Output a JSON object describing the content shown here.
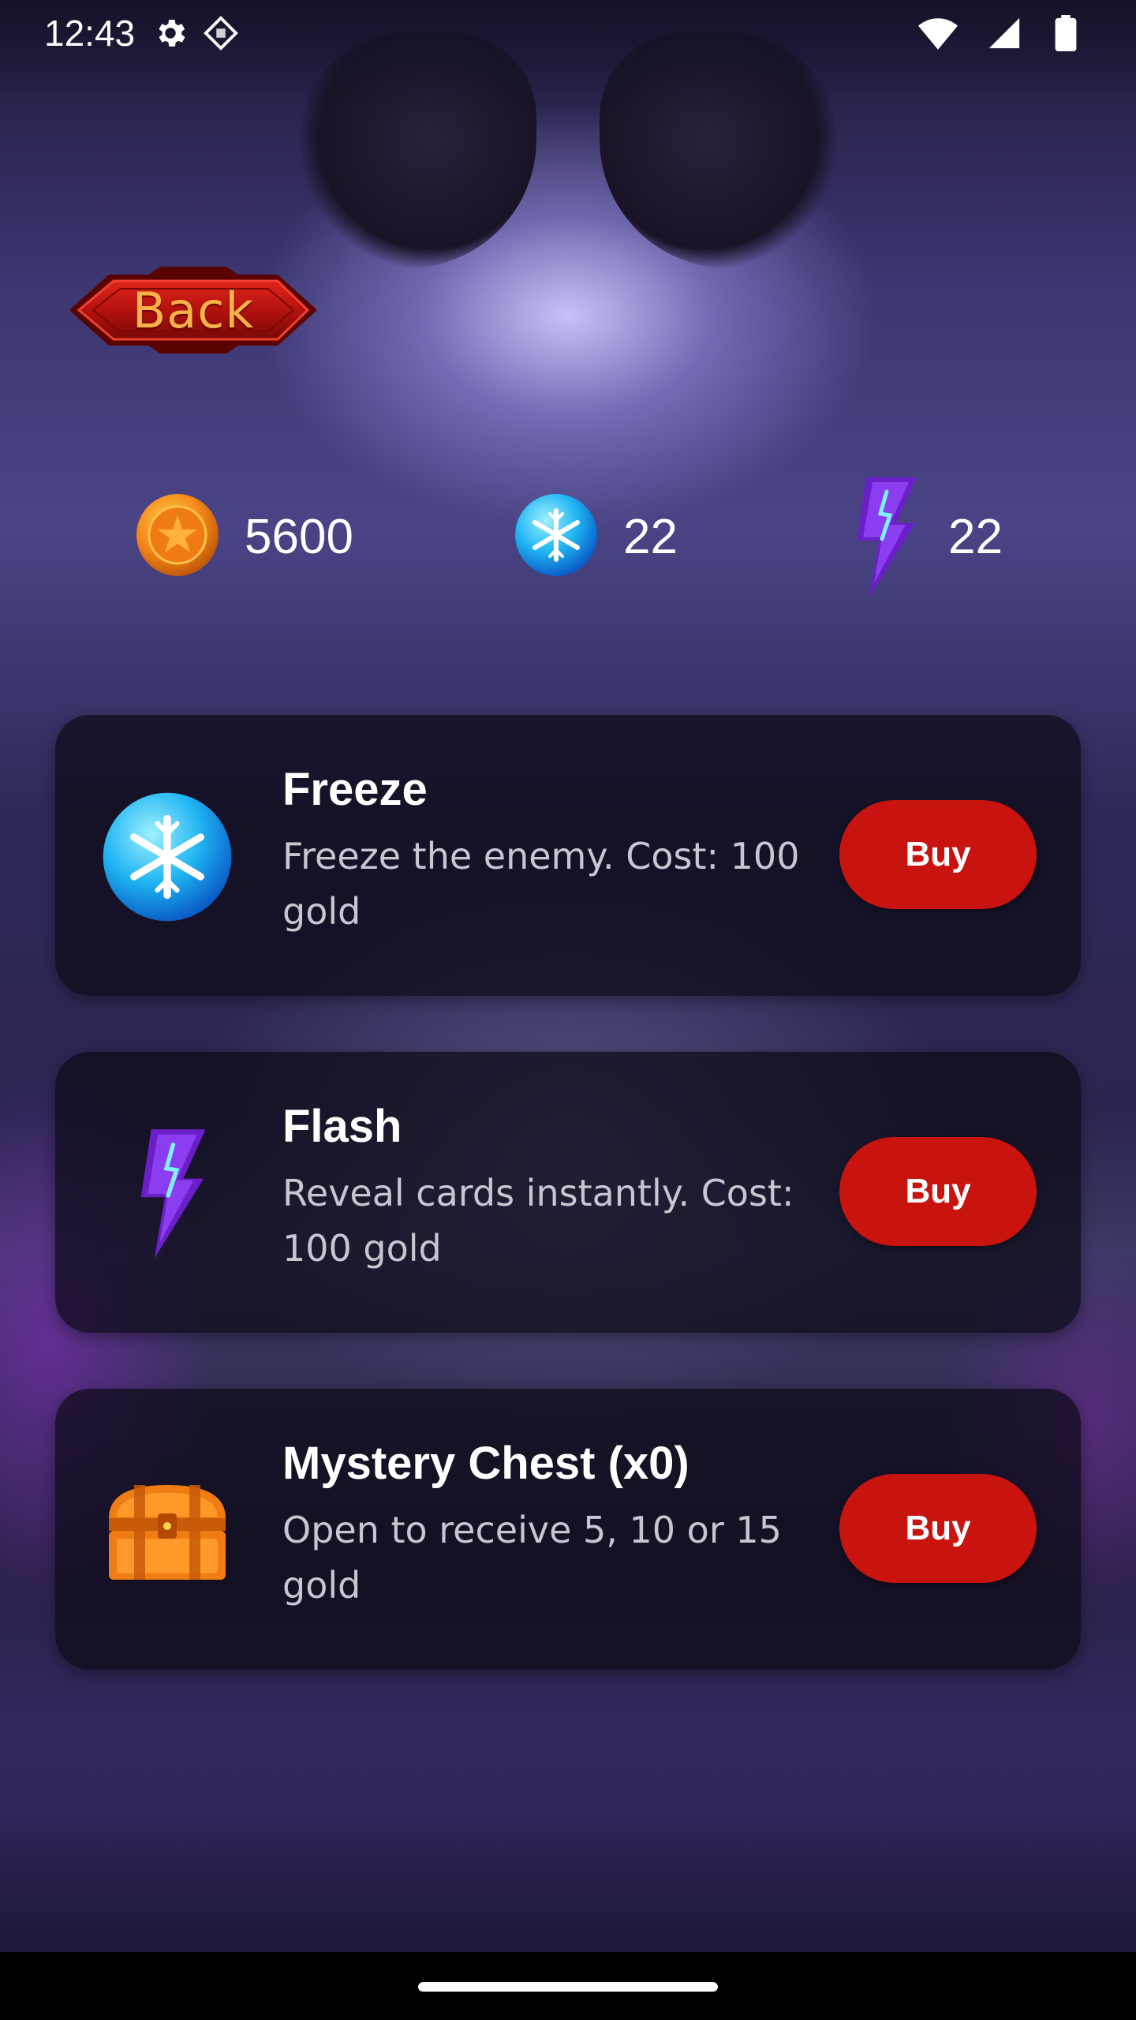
{
  "status_bar": {
    "time": "12:43",
    "icons_left": [
      "settings-icon",
      "debug-diamond-icon"
    ],
    "icons_right": [
      "wifi-icon",
      "signal-icon",
      "battery-icon"
    ]
  },
  "back_button": {
    "label": "Back",
    "fill_color": "#b4120e",
    "text_color": "#f8b24a"
  },
  "currencies": [
    {
      "id": "gold",
      "icon": "gold-coin-icon",
      "value": "5600"
    },
    {
      "id": "freeze",
      "icon": "freeze-orb-icon",
      "value": "22"
    },
    {
      "id": "flash",
      "icon": "lightning-bolt-icon",
      "value": "22"
    }
  ],
  "shop_items": [
    {
      "id": "freeze",
      "icon": "freeze-orb-icon",
      "title": "Freeze",
      "desc_line1": "Freeze the enemy. Cost: 100",
      "desc_line2": "gold",
      "button_label": "Buy"
    },
    {
      "id": "flash",
      "icon": "lightning-bolt-icon",
      "title": "Flash",
      "desc_line1": "Reveal cards instantly. Cost:",
      "desc_line2": "100 gold",
      "button_label": "Buy"
    },
    {
      "id": "mystery-chest",
      "icon": "treasure-chest-icon",
      "title": "Mystery Chest (x0)",
      "desc_line1": "Open to receive 5, 10 or 15",
      "desc_line2": "gold",
      "button_label": "Buy"
    }
  ],
  "colors": {
    "buy_button": "#c8130f",
    "card_background": "rgba(12,10,22,0.72)",
    "description_text": "#c9c6cf"
  }
}
